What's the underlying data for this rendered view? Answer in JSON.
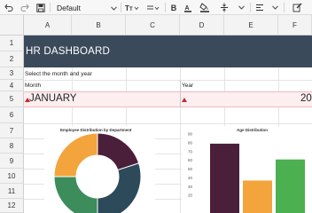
{
  "toolbar": {
    "font_name": "Default",
    "bold_label": "B",
    "italic_label": "I",
    "underline_label": "U"
  },
  "columns": [
    "A",
    "B",
    "C",
    "D",
    "E",
    "F"
  ],
  "rows": [
    "1",
    "2",
    "3",
    "4",
    "5",
    "6",
    "7",
    "8",
    "9",
    "10",
    "11",
    "12"
  ],
  "sheet": {
    "banner_title": "HR DASHBOARD",
    "instruction": "Select the month and year",
    "month_label": "Month",
    "year_label": "Year",
    "month_value": "JANUARY",
    "year_value": "20"
  },
  "colors": {
    "banner": "#3b4a5a",
    "accent_red": "#c62828",
    "series_purple": "#4a1f3a",
    "series_orange": "#f4a43c",
    "series_green": "#4caf50",
    "series_teal": "#2d4a5a",
    "series_green_dark": "#3c8c5c"
  },
  "charts": [
    {
      "chart_data": {
        "type": "pie",
        "title": "Employee Distribution by Department",
        "slices": [
          {
            "color": "#4a1f3a",
            "value": 20
          },
          {
            "color": "#2d4a5a",
            "value": 30
          },
          {
            "color": "#3c8c5c",
            "value": 25
          },
          {
            "color": "#f4a43c",
            "value": 25
          }
        ]
      }
    },
    {
      "chart_data": {
        "type": "bar",
        "title": "Age Distribution",
        "categories": [
          "",
          "",
          ""
        ],
        "values": [
          79,
          37,
          61
        ],
        "colors": [
          "#4a1f3a",
          "#f4a43c",
          "#4caf50"
        ],
        "yticks": [
          "90",
          "80",
          "70",
          "60",
          "50",
          "40",
          "30",
          "20"
        ],
        "ylim": [
          0,
          90
        ]
      }
    }
  ]
}
